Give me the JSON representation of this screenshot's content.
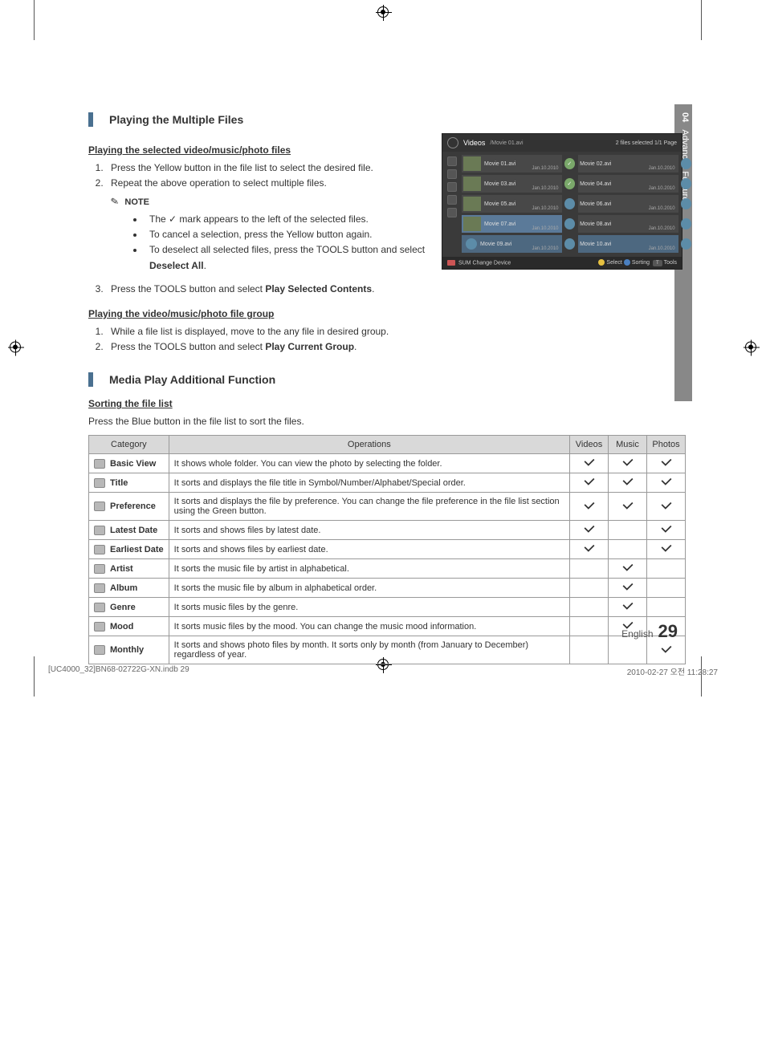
{
  "chapter_tab": {
    "num": "04",
    "title": "Advanced Features"
  },
  "section1": {
    "title": "Playing the Multiple Files",
    "sub1": "Playing the selected video/music/photo files",
    "steps1": [
      "Press the Yellow button in the file list to select the desired file.",
      "Repeat the above operation to select multiple files."
    ],
    "note_label": "NOTE",
    "notes": [
      "The ✓ mark appears to the left of the selected files.",
      "To cancel a selection, press the Yellow button again.",
      "To deselect all selected files, press the TOOLS button and select Deselect All."
    ],
    "step3": "Press the TOOLS button and select Play Selected Contents.",
    "sub2": "Playing the video/music/photo file group",
    "steps2": [
      "While a file list is displayed, move to the any file in desired group.",
      "Press the TOOLS button and select Play Current Group."
    ]
  },
  "screenshot": {
    "header_title": "Videos",
    "header_path": "/Movie 01.avi",
    "header_status": "2 files selected   1/1 Page",
    "items": [
      {
        "name": "Movie 01.avi",
        "date": "Jan.10.2010",
        "badge": "✓"
      },
      {
        "name": "Movie 02.avi",
        "date": "Jan.10.2010",
        "badge": ""
      },
      {
        "name": "Movie 03.avi",
        "date": "Jan.10.2010",
        "badge": "✓"
      },
      {
        "name": "Movie 04.avi",
        "date": "Jan.10.2010",
        "badge": ""
      },
      {
        "name": "Movie 05.avi",
        "date": "Jan.10.2010",
        "badge": ""
      },
      {
        "name": "Movie 06.avi",
        "date": "Jan.10.2010",
        "badge": ""
      },
      {
        "name": "Movie 07.avi",
        "date": "Jan.10.2010",
        "badge": ""
      },
      {
        "name": "Movie 08.avi",
        "date": "Jan.10.2010",
        "badge": ""
      },
      {
        "name": "Movie 09.avi",
        "date": "Jan.10.2010",
        "badge": ""
      },
      {
        "name": "Movie 10.avi",
        "date": "Jan.10.2010",
        "badge": ""
      }
    ],
    "footer_left": "SUM   Change Device",
    "footer_select": "Select",
    "footer_sort": "Sorting",
    "footer_tools": "Tools"
  },
  "section2": {
    "title": "Media Play Additional Function",
    "sub": "Sorting the file list",
    "intro": "Press the Blue button in the file list to sort the files."
  },
  "table": {
    "headers": [
      "Category",
      "Operations",
      "Videos",
      "Music",
      "Photos"
    ],
    "rows": [
      {
        "cat": "Basic View",
        "op": "It shows whole folder. You can view the photo by selecting the folder.",
        "v": true,
        "m": true,
        "p": true
      },
      {
        "cat": "Title",
        "op": "It sorts and displays the file title in Symbol/Number/Alphabet/Special order.",
        "v": true,
        "m": true,
        "p": true
      },
      {
        "cat": "Preference",
        "op": "It sorts and displays the file by preference. You can change the file preference in the file list section using the Green button.",
        "v": true,
        "m": true,
        "p": true
      },
      {
        "cat": "Latest Date",
        "op": "It sorts and shows files by latest date.",
        "v": true,
        "m": false,
        "p": true
      },
      {
        "cat": "Earliest Date",
        "op": "It sorts and shows files by earliest date.",
        "v": true,
        "m": false,
        "p": true
      },
      {
        "cat": "Artist",
        "op": "It sorts the music file by artist in alphabetical.",
        "v": false,
        "m": true,
        "p": false
      },
      {
        "cat": "Album",
        "op": "It sorts the music file by album in alphabetical order.",
        "v": false,
        "m": true,
        "p": false
      },
      {
        "cat": "Genre",
        "op": "It sorts music files by the genre.",
        "v": false,
        "m": true,
        "p": false
      },
      {
        "cat": "Mood",
        "op": "It sorts music files by the mood. You can change the music mood information.",
        "v": false,
        "m": true,
        "p": false
      },
      {
        "cat": "Monthly",
        "op": "It sorts and shows photo files by month. It sorts only by month (from January to December) regardless of year.",
        "v": false,
        "m": false,
        "p": true
      }
    ]
  },
  "footer": {
    "lang": "English",
    "page": "29"
  },
  "print": {
    "left": "[UC4000_32]BN68-02722G-XN.indb   29",
    "right": "2010-02-27   오전 11:28:27"
  }
}
